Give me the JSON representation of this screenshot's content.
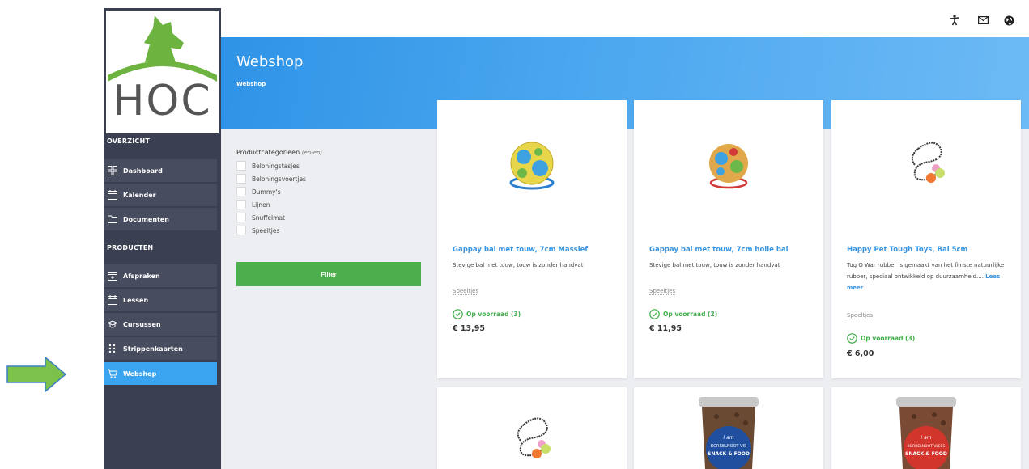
{
  "sidebar": {
    "logo_text": "HOC",
    "section_overzicht": "OVERZICHT",
    "section_producten": "PRODUCTEN",
    "items": [
      {
        "label": "Dashboard",
        "icon": "dashboard-icon"
      },
      {
        "label": "Kalender",
        "icon": "calendar-icon"
      },
      {
        "label": "Documenten",
        "icon": "folder-icon"
      },
      {
        "label": "Afspraken",
        "icon": "calendar-plus-icon"
      },
      {
        "label": "Lessen",
        "icon": "calendar-icon"
      },
      {
        "label": "Cursussen",
        "icon": "graduation-cap-icon"
      },
      {
        "label": "Strippenkaarten",
        "icon": "dots-grid-icon"
      },
      {
        "label": "Webshop",
        "icon": "cart-icon",
        "active": true
      }
    ]
  },
  "header": {
    "title": "Webshop",
    "breadcrumb": "Webshop",
    "icons": [
      "accessibility-icon",
      "mail-icon",
      "globe-icon"
    ]
  },
  "filter": {
    "title": "Productcategorieën",
    "title_suffix": "(en-en)",
    "categories": [
      "Beloningstasjes",
      "Beloningsvoertjes",
      "Dummy's",
      "Lijnen",
      "Snuffelmat",
      "Speeltjes"
    ],
    "button_label": "Filter"
  },
  "products": [
    {
      "name": "Gappay bal met touw, 7cm Massief",
      "description": "Stevige bal met touw, touw is zonder handvat",
      "more": "",
      "category": "Speeltjes",
      "stock": "Op voorraad (3)",
      "price": "€ 13,95"
    },
    {
      "name": "Gappay bal met touw, 7cm holle bal",
      "description": "Stevige bal met touw, touw is zonder handvat",
      "more": "",
      "category": "Speeltjes",
      "stock": "Op voorraad (2)",
      "price": "€ 11,95"
    },
    {
      "name": "Happy Pet Tough Toys, Bal 5cm",
      "description": "Tug O War rubber is gemaakt van het fijnste natuurlijke rubber, speciaal ontwikkeld op duurzaamheid....",
      "more": "Lees meer",
      "category": "Speeltjes",
      "stock": "Op voorraad (3)",
      "price": "€ 6,00"
    }
  ],
  "jar_labels": {
    "jar1": [
      "I am",
      "BORRELNOOT VIS",
      "SNACK & FOOD"
    ],
    "jar2": [
      "I am",
      "BORRELNOOT VLEES",
      "SNACK & FOOD"
    ]
  },
  "colors": {
    "sidebar": "#3a3f51",
    "accent": "#3aa4f0",
    "green": "#4cae4c",
    "link": "#3a95e0"
  }
}
